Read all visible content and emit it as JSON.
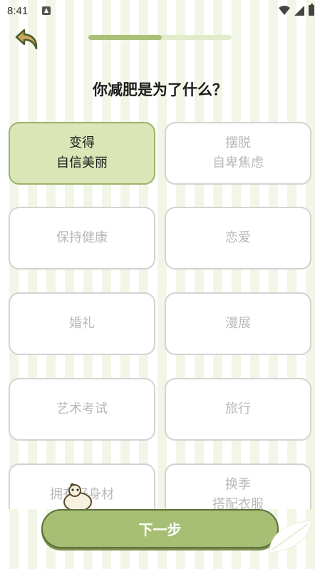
{
  "status_bar": {
    "time": "8:41"
  },
  "header": {
    "progress": 0.51
  },
  "question": "你减肥是为了什么？",
  "options": [
    {
      "line1": "变得",
      "line2": "自信美丽",
      "selected": true
    },
    {
      "line1": "摆脱",
      "line2": "自卑焦虑",
      "selected": false
    },
    {
      "line1": "保持健康",
      "line2": "",
      "selected": false
    },
    {
      "line1": "恋爱",
      "line2": "",
      "selected": false
    },
    {
      "line1": "婚礼",
      "line2": "",
      "selected": false
    },
    {
      "line1": "漫展",
      "line2": "",
      "selected": false
    },
    {
      "line1": "艺术考试",
      "line2": "",
      "selected": false
    },
    {
      "line1": "旅行",
      "line2": "",
      "selected": false
    },
    {
      "line1": "拥有好身材",
      "line2": "",
      "selected": false
    },
    {
      "line1": "换季",
      "line2": "搭配衣服",
      "selected": false
    }
  ],
  "next_button": {
    "label": "下一步"
  },
  "colors": {
    "accent": "#a6bf74",
    "selected_bg": "#dbe6b7",
    "selected_border": "#9cb26a",
    "unselected_border": "#d3d3d3"
  },
  "icons": {
    "back": "back-arrow-icon",
    "wifi": "wifi-icon",
    "signal": "signal-icon",
    "battery": "battery-icon"
  }
}
